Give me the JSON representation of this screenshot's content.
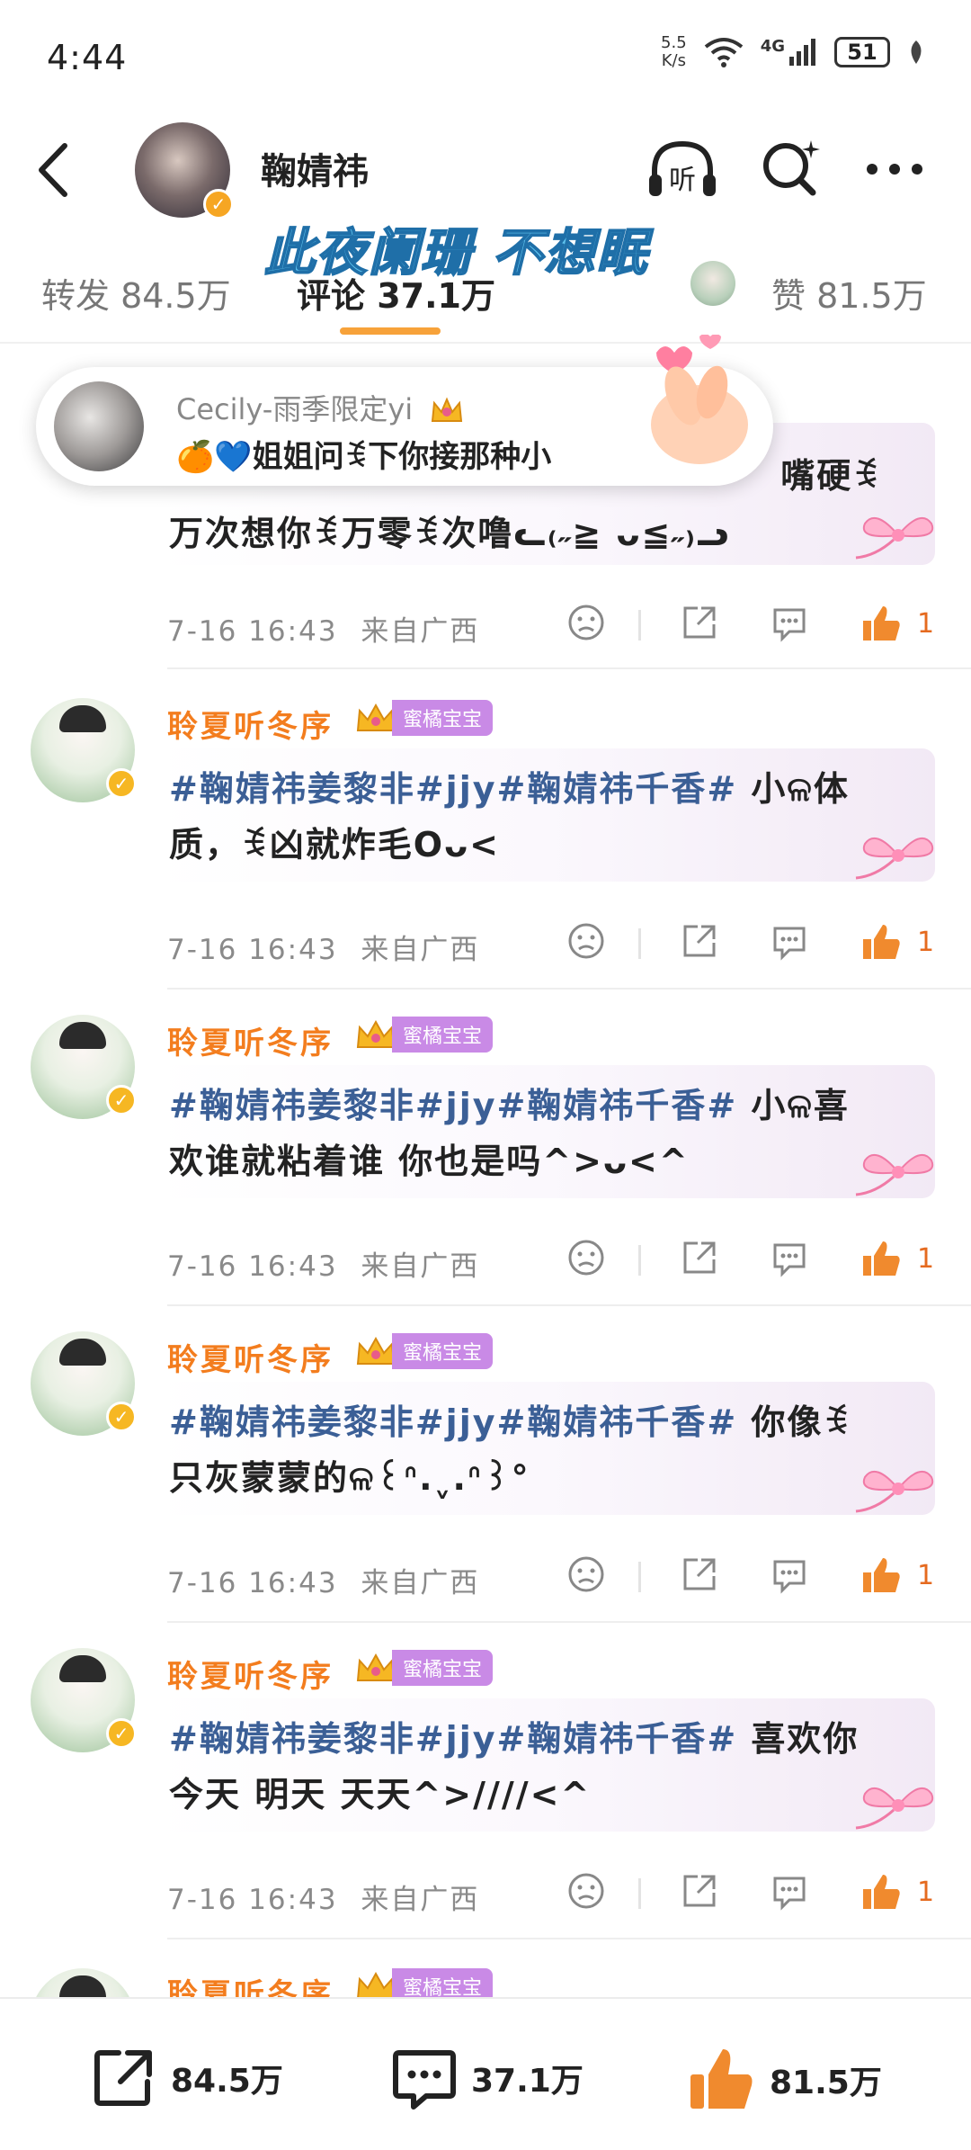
{
  "status_bar": {
    "time": "4:44",
    "net_speed_value": "5.5",
    "net_speed_unit": "K/s",
    "network_type": "4G",
    "battery": "51"
  },
  "header": {
    "title": "鞠婧祎",
    "listen_label": "听"
  },
  "banner_text": "此夜阑珊 不想眠",
  "tabs": [
    {
      "label": "转发 84.5万"
    },
    {
      "label": "评论 37.1万"
    },
    {
      "label": "赞 81.5万"
    }
  ],
  "floating_card": {
    "name": "Cecily-雨季限定yi",
    "text": "🍊💙姐姐问ꉂ下你接那种小"
  },
  "partial_comment": {
    "line1_tail": "嘴硬ꉂ",
    "line2": "万次想你ꉂ万零ꉂ次噜ᓚ₍˶≧ ᴗ≦˶₎ᓗ",
    "time": "7-16 16:43",
    "location": "来自广西",
    "likes": "1"
  },
  "comments": [
    {
      "name": "聆夏听冬序",
      "badge": "蜜橘宝宝",
      "topic": "#鞠婧祎姜黎非#jjy#鞠婧祎千香#",
      "text_rest": " 小ଳ体",
      "line2": "质，ꉂ凶就炸毛Oᴗ<",
      "time": "7-16 16:43",
      "location": "来自广西",
      "likes": "1"
    },
    {
      "name": "聆夏听冬序",
      "badge": "蜜橘宝宝",
      "topic": "#鞠婧祎姜黎非#jjy#鞠婧祎千香#",
      "text_rest": " 小ଳ喜",
      "line2": "欢谁就粘着谁 你也是吗^>ᴗ<^",
      "time": "7-16 16:43",
      "location": "来自广西",
      "likes": "1"
    },
    {
      "name": "聆夏听冬序",
      "badge": "蜜橘宝宝",
      "topic": "#鞠婧祎姜黎非#jjy#鞠婧祎千香#",
      "text_rest": " 你像ꉂ",
      "line2": "只灰蒙蒙的ଳ꒰ᐢ.ˬ.ᐢ꒱°",
      "time": "7-16 16:43",
      "location": "来自广西",
      "likes": "1"
    },
    {
      "name": "聆夏听冬序",
      "badge": "蜜橘宝宝",
      "topic": "#鞠婧祎姜黎非#jjy#鞠婧祎千香#",
      "text_rest": " 喜欢你",
      "line2": "今天 明天 天天^>////<^",
      "time": "7-16 16:43",
      "location": "来自广西",
      "likes": "1"
    }
  ],
  "peek_comment": {
    "name": "聆夏听冬序",
    "badge": "蜜橘宝宝"
  },
  "bottom_bar": {
    "repost": "84.5万",
    "comment": "37.1万",
    "like": "81.5万"
  },
  "colors": {
    "accent": "#f7a23a",
    "name_orange": "#f37d1e",
    "topic_blue": "#3b5f96",
    "like_orange": "#e56a1f",
    "badge_purple": "#c98ae6"
  }
}
